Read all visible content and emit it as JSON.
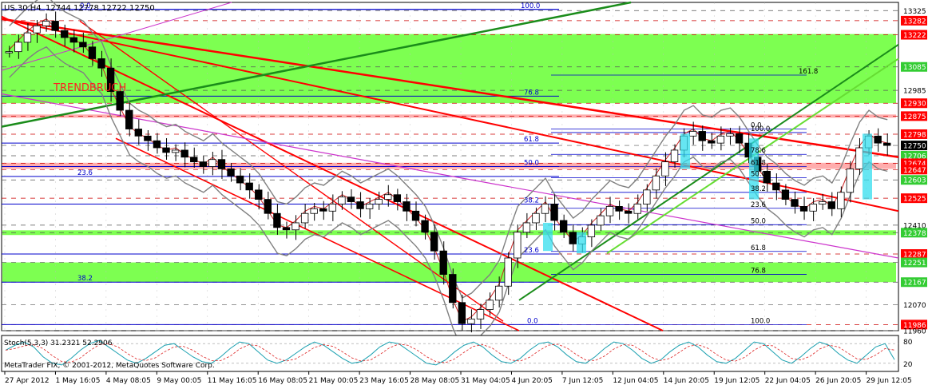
{
  "window": {
    "symbol_header": "US.30,H4",
    "ohlc_header": "12744 12778 12722 12750",
    "copyright": "MetaTrader FIX, © 2001-2012, MetaQuotes Software Corp.",
    "annotation": "TRENDBRUCH"
  },
  "colors": {
    "grid": "#888888",
    "zone_green": "#66ff33",
    "zone_red": "#ff9999",
    "trend_red": "#ff0000",
    "trend_green": "#1a8c1a",
    "magenta": "#cc33cc",
    "blue": "#0000cc",
    "band_gray": "#808080",
    "price_box_red": "#ff0000",
    "price_box_green": "#33cc33",
    "price_box_dark": "#000000",
    "cyan": "#33ddee"
  },
  "chart_data": [
    {
      "type": "candlestick",
      "title": "US.30,H4",
      "ylim": [
        11960,
        13360
      ],
      "grid": true,
      "price_labels": [
        {
          "text": "13325",
          "value": 13325,
          "style": "plain"
        },
        {
          "text": "13282",
          "value": 13282,
          "style": "red"
        },
        {
          "text": "13222",
          "value": 13222,
          "style": "red"
        },
        {
          "text": "13085",
          "value": 13085,
          "style": "green"
        },
        {
          "text": "12985",
          "value": 12985,
          "style": "plain"
        },
        {
          "text": "12930",
          "value": 12930,
          "style": "red"
        },
        {
          "text": "12875",
          "value": 12875,
          "style": "red"
        },
        {
          "text": "12798",
          "value": 12798,
          "style": "red"
        },
        {
          "text": "12750",
          "value": 12750,
          "style": "dark"
        },
        {
          "text": "12706",
          "value": 12706,
          "style": "green"
        },
        {
          "text": "12674",
          "value": 12674,
          "style": "red"
        },
        {
          "text": "12647",
          "value": 12647,
          "style": "red"
        },
        {
          "text": "12603",
          "value": 12603,
          "style": "green"
        },
        {
          "text": "12525",
          "value": 12525,
          "style": "red"
        },
        {
          "text": "12410",
          "value": 12410,
          "style": "plain"
        },
        {
          "text": "12378",
          "value": 12378,
          "style": "green"
        },
        {
          "text": "12287",
          "value": 12287,
          "style": "red"
        },
        {
          "text": "12251",
          "value": 12251,
          "style": "green"
        },
        {
          "text": "12167",
          "value": 12167,
          "style": "green"
        },
        {
          "text": "12070",
          "value": 12070,
          "style": "plain"
        },
        {
          "text": "11986",
          "value": 11986,
          "style": "red"
        },
        {
          "text": "11960",
          "value": 11960,
          "style": "plain"
        }
      ],
      "x_ticks": [
        "27 Apr 2012",
        "1 May 16:05",
        "4 May 08:05",
        "9 May 00:05",
        "11 May 16:05",
        "16 May 08:05",
        "21 May 00:05",
        "23 May 16:05",
        "28 May 08:05",
        "31 May 04:05",
        "4 Jun 20:05",
        "7 Jun 12:05",
        "12 Jun 04:05",
        "14 Jun 20:05",
        "19 Jun 12:05",
        "22 Jun 04:05",
        "26 Jun 20:05",
        "29 Jun 12:05"
      ],
      "zones": [
        {
          "from": 12930,
          "to": 13225,
          "color": "green"
        },
        {
          "from": 12167,
          "to": 12251,
          "color": "green"
        },
        {
          "from": 12368,
          "to": 12388,
          "color": "green"
        },
        {
          "from": 12650,
          "to": 12676,
          "color": "red"
        },
        {
          "from": 12868,
          "to": 12882,
          "color": "red"
        }
      ],
      "fib_levels_left": [
        {
          "label": "0.0",
          "value": 13330
        },
        {
          "label": "100.0",
          "value": 13330
        },
        {
          "label": "76.8",
          "value": 12960
        },
        {
          "label": "61.8",
          "value": 12760
        },
        {
          "label": "50.0",
          "value": 12660
        },
        {
          "label": "38.2",
          "value": 12500
        },
        {
          "label": "23.6",
          "value": 12287
        },
        {
          "label": "0.0",
          "value": 11986
        },
        {
          "label": "23.6",
          "value": 12618
        },
        {
          "label": "38.2",
          "value": 12167
        }
      ],
      "fib_levels_right": [
        {
          "label": "161.8",
          "value": 13050
        },
        {
          "label": "0.0",
          "value": 12820
        },
        {
          "label": "100.0",
          "value": 12805
        },
        {
          "label": "78.6",
          "value": 12712
        },
        {
          "label": "61.8",
          "value": 12660
        },
        {
          "label": "50.0",
          "value": 12612
        },
        {
          "label": "38.2",
          "value": 12550
        },
        {
          "label": "23.6",
          "value": 12482
        },
        {
          "label": "50.0",
          "value": 12412
        },
        {
          "label": "61.8",
          "value": 12298
        },
        {
          "label": "76.8",
          "value": 12200
        },
        {
          "label": "100.0",
          "value": 11986
        }
      ],
      "close_series": [
        13150,
        13190,
        13230,
        13260,
        13280,
        13240,
        13210,
        13190,
        13170,
        13120,
        13080,
        12980,
        12900,
        12820,
        12790,
        12770,
        12740,
        12720,
        12730,
        12700,
        12680,
        12660,
        12690,
        12650,
        12620,
        12590,
        12560,
        12520,
        12460,
        12400,
        12390,
        12420,
        12460,
        12480,
        12470,
        12500,
        12530,
        12510,
        12480,
        12500,
        12520,
        12540,
        12510,
        12470,
        12430,
        12380,
        12300,
        12200,
        12080,
        11990,
        12010,
        12050,
        12090,
        12150,
        12270,
        12380,
        12420,
        12460,
        12500,
        12430,
        12380,
        12330,
        12360,
        12410,
        12450,
        12490,
        12470,
        12460,
        12500,
        12560,
        12620,
        12680,
        12730,
        12790,
        12810,
        12770,
        12760,
        12790,
        12800,
        12760,
        12700,
        12640,
        12590,
        12560,
        12520,
        12490,
        12470,
        12500,
        12510,
        12480,
        12550,
        12650,
        12740,
        12790,
        12760,
        12750
      ]
    },
    {
      "type": "line",
      "title": "Stoch(5,3,3) 31.2321 52.2906",
      "ylim": [
        0,
        100
      ],
      "y_ticks": [
        "80",
        "20"
      ],
      "series": [
        {
          "name": "Stoch(5,3,3)",
          "last": 31.2321
        },
        {
          "name": "Signal",
          "last": 52.2906
        }
      ],
      "values_main": [
        60,
        75,
        85,
        70,
        40,
        20,
        15,
        35,
        60,
        80,
        90,
        70,
        50,
        30,
        20,
        35,
        55,
        75,
        80,
        60,
        40,
        25,
        20,
        40,
        65,
        85,
        80,
        55,
        30,
        20,
        30,
        50,
        70,
        85,
        75,
        55,
        35,
        20,
        25,
        45,
        70,
        85,
        80,
        60,
        40,
        20,
        15,
        30,
        55,
        75,
        85,
        70,
        45,
        25,
        20,
        35,
        60,
        80,
        85,
        70,
        45,
        25,
        20,
        40,
        65,
        85,
        80,
        60,
        35,
        20,
        30,
        55,
        75,
        85,
        70,
        45,
        25,
        20,
        35,
        60,
        85,
        80,
        55,
        30,
        20,
        40,
        65,
        85,
        75,
        50,
        30,
        20,
        45,
        70,
        80,
        31
      ]
    }
  ]
}
